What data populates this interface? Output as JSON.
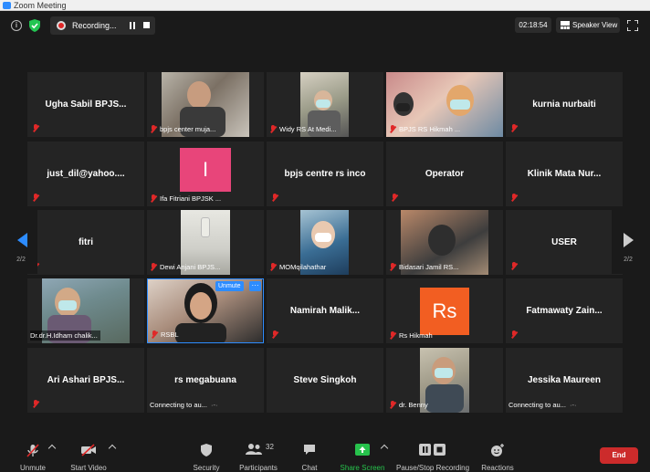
{
  "window": {
    "title": "Zoom Meeting"
  },
  "topbar": {
    "recording_label": "Recording...",
    "timer": "02:18:54",
    "view_label": "Speaker View"
  },
  "pagination": {
    "left": "2/2",
    "right": "2/2"
  },
  "tiles": [
    {
      "name": "Ugha Sabil BPJS...",
      "video": false
    },
    {
      "name": "bpjs center muja...",
      "video": true
    },
    {
      "name": "Widy RS At Medi...",
      "video": true
    },
    {
      "name": "BPJS RS Hikmah ...",
      "video": true
    },
    {
      "name": "kurnia nurbaiti",
      "video": false
    },
    {
      "name": "just_dil@yahoo....",
      "video": false
    },
    {
      "name": "Ifa Fitriani BPJSK ...",
      "video": false,
      "avatar_letter": "I"
    },
    {
      "name": "bpjs centre rs inco",
      "video": false
    },
    {
      "name": "Operator",
      "video": false
    },
    {
      "name": "Klinik Mata Nur...",
      "video": false
    },
    {
      "name": "fitri",
      "video": false
    },
    {
      "name": "Dewi Anjani BPJS...",
      "video": true
    },
    {
      "name": "MOMqilahathar",
      "video": true
    },
    {
      "name": "Bidasari Jamil RS...",
      "video": true
    },
    {
      "name": "USER",
      "video": false
    },
    {
      "name": "Dr.dr.H.Idham chalik...",
      "video": true
    },
    {
      "name": "RSBL",
      "video": true,
      "unmute_label": "Unmute",
      "more_label": "···"
    },
    {
      "name": "Namirah  Malik...",
      "video": false
    },
    {
      "name": "Rs Hikmah",
      "video": false,
      "avatar_letter": "Rs"
    },
    {
      "name": "Fatmawaty  Zain...",
      "video": false
    },
    {
      "name": "Ari Ashari BPJS...",
      "video": false
    },
    {
      "name": "rs megabuana",
      "video": false,
      "status": "Connecting to au..."
    },
    {
      "name": "Steve Singkoh",
      "video": false
    },
    {
      "name": "dr. Benny",
      "video": true
    },
    {
      "name": "Jessika Maureen",
      "video": false,
      "status": "Connecting to au..."
    }
  ],
  "toolbar": {
    "unmute": "Unmute",
    "start_video": "Start Video",
    "security": "Security",
    "participants": "Participants",
    "participants_count": "32",
    "chat": "Chat",
    "share_screen": "Share Screen",
    "recording": "Pause/Stop Recording",
    "reactions": "Reactions",
    "end": "End"
  },
  "colors": {
    "accent": "#2d8cff",
    "end": "#cc2b2b",
    "share": "#27c24c",
    "muted": "#e02828"
  }
}
